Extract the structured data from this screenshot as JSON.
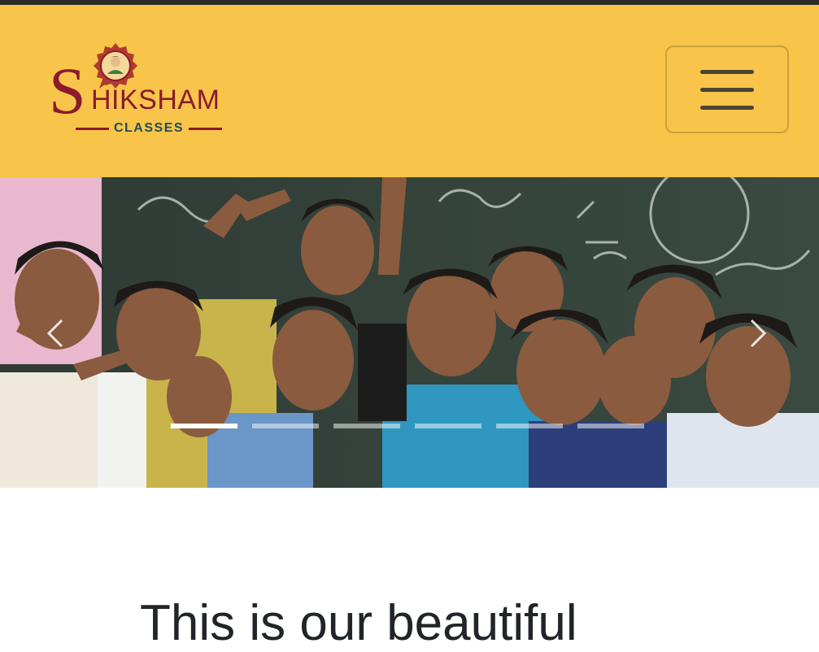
{
  "brand": {
    "initial": "S",
    "name_rest": "HIKSHAM",
    "subtitle": "CLASSES",
    "colors": {
      "navbar": "#f8c54a",
      "maroon": "#8b1a2e",
      "teal": "#1e4d55"
    }
  },
  "navbar": {
    "toggle_icon": "hamburger-menu-icon"
  },
  "carousel": {
    "prev_icon": "chevron-left-icon",
    "next_icon": "chevron-right-icon",
    "slide_count": 6,
    "active_index": 0
  },
  "content": {
    "heading": "This is our beautiful"
  }
}
